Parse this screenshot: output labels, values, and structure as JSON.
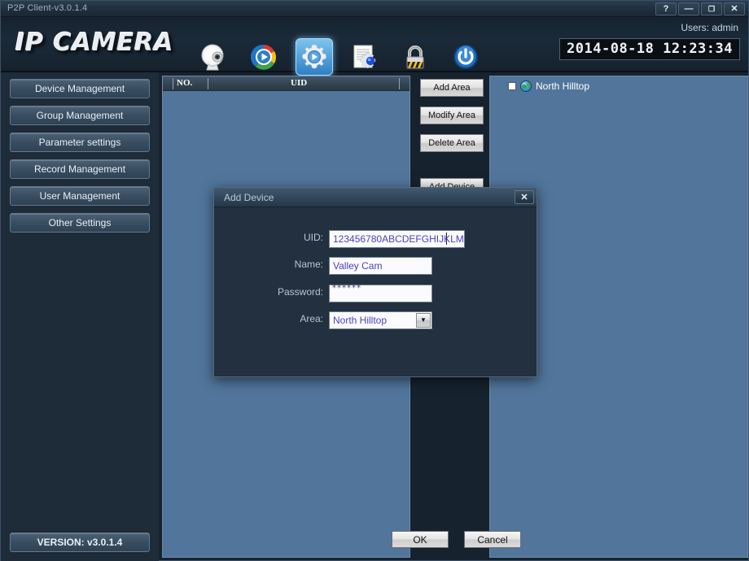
{
  "window": {
    "title": "P2P Client-v3.0.1.4",
    "controls": [
      {
        "name": "help",
        "glyph": "?"
      },
      {
        "name": "minimize",
        "glyph": "—"
      },
      {
        "name": "maximize",
        "glyph": "❐"
      },
      {
        "name": "close",
        "glyph": "✕"
      }
    ]
  },
  "header": {
    "logo": "IP CAMERA",
    "user_label": "Users: admin",
    "datetime": "2014-08-18 12:23:34",
    "toolbar": [
      {
        "icon": "camera-icon",
        "selected": false
      },
      {
        "icon": "live-play-icon",
        "selected": false
      },
      {
        "icon": "settings-gear-play-icon",
        "selected": true
      },
      {
        "icon": "log-document-gear-icon",
        "selected": false
      },
      {
        "icon": "lock-icon",
        "selected": false
      },
      {
        "icon": "power-icon",
        "selected": false
      }
    ]
  },
  "sidebar": {
    "items": [
      {
        "label": "Device Management"
      },
      {
        "label": "Group Management"
      },
      {
        "label": "Parameter settings"
      },
      {
        "label": "Record Management"
      },
      {
        "label": "User Management"
      },
      {
        "label": "Other Settings"
      }
    ],
    "version_label": "VERSION: v3.0.1.4"
  },
  "device_list": {
    "columns": [
      "NO.",
      "UID"
    ],
    "rows": []
  },
  "action_buttons": [
    {
      "label": "Add Area"
    },
    {
      "label": "Modify Area"
    },
    {
      "label": "Delete Area"
    },
    {
      "label": "Add Device"
    }
  ],
  "area_tree": {
    "nodes": [
      {
        "label": "North Hilltop",
        "checked": false,
        "icon": "globe-icon"
      }
    ]
  },
  "dialog": {
    "title": "Add Device",
    "close_glyph": "✕",
    "fields": {
      "uid": {
        "label": "UID:",
        "value": "123456780ABCDEFGHIJKLM"
      },
      "name": {
        "label": "Name:",
        "value": "Valley Cam"
      },
      "password": {
        "label": "Password:",
        "value": "******"
      },
      "area": {
        "label": "Area:",
        "value": "North Hilltop",
        "options": [
          "North Hilltop"
        ]
      }
    },
    "ok_label": "OK",
    "cancel_label": "Cancel"
  },
  "colors": {
    "panel_blue": "#51759b",
    "chrome_dark": "#16222e",
    "sidebar_dark": "#1e2b38",
    "accent_select": "#5fb4ea",
    "input_text": "#4a3fbf"
  }
}
